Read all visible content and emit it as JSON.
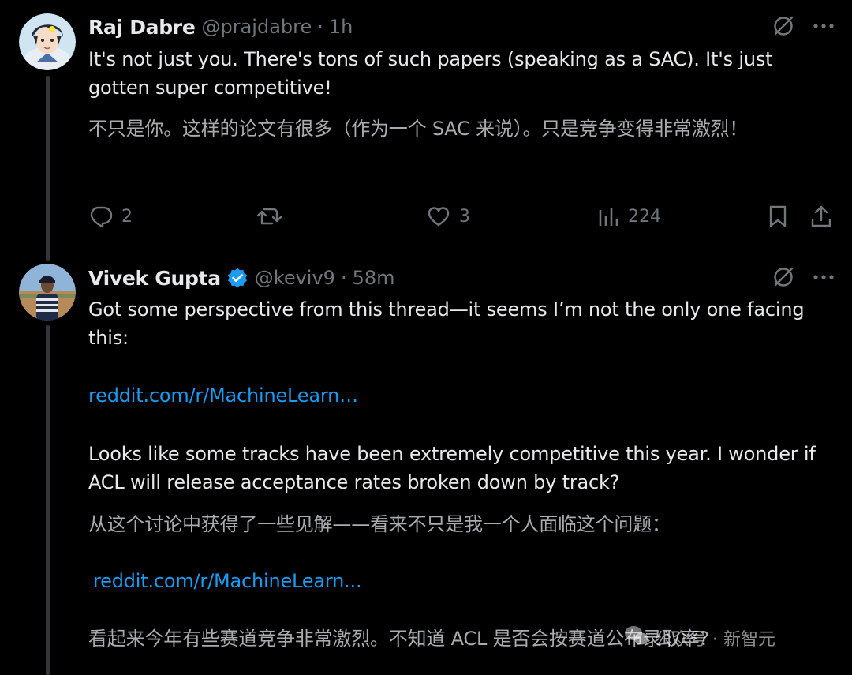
{
  "tweets": [
    {
      "name": "Raj Dabre",
      "handle": "@prajdabre",
      "separator": "·",
      "time": "1h",
      "verified": false,
      "text_en": "It's not just you. There's tons of such papers (speaking as a SAC). It's just gotten super competitive!",
      "text_cn": "不只是你。这样的论文有很多（作为一个 SAC 来说）。只是竞争变得非常激烈！",
      "actions": {
        "replies": "2",
        "retweets": "",
        "likes": "3",
        "views": "224"
      }
    },
    {
      "name": "Vivek Gupta",
      "handle": "@keviv9",
      "separator": "·",
      "time": "58m",
      "verified": true,
      "text_en_1": "Got some perspective from this thread—it seems I’m not the only one facing this:",
      "link_1": "reddit.com/r/MachineLearn…",
      "text_en_2": "Looks like some tracks have been extremely competitive this year. I wonder if ACL will release acceptance rates broken down by track?",
      "text_cn_1": "从这个讨论中获得了一些见解——看来不只是我一个人面临这个问题：",
      "link_2": "reddit.com/r/MachineLearn...",
      "text_cn_2": "看起来今年有些赛道竞争非常激烈。不知道 ACL 是否会按赛道公布录取率?"
    }
  ],
  "watermark": {
    "label": "公众号 · 新智元"
  },
  "colors": {
    "background": "#000000",
    "text": "#e7e9ea",
    "muted": "#71767b",
    "link": "#1d9bf0",
    "verified": "#1d9bf0"
  },
  "icons": [
    "grok-icon",
    "more-icon",
    "reply-icon",
    "retweet-icon",
    "like-icon",
    "views-icon",
    "bookmark-icon",
    "share-icon",
    "verified-icon"
  ]
}
